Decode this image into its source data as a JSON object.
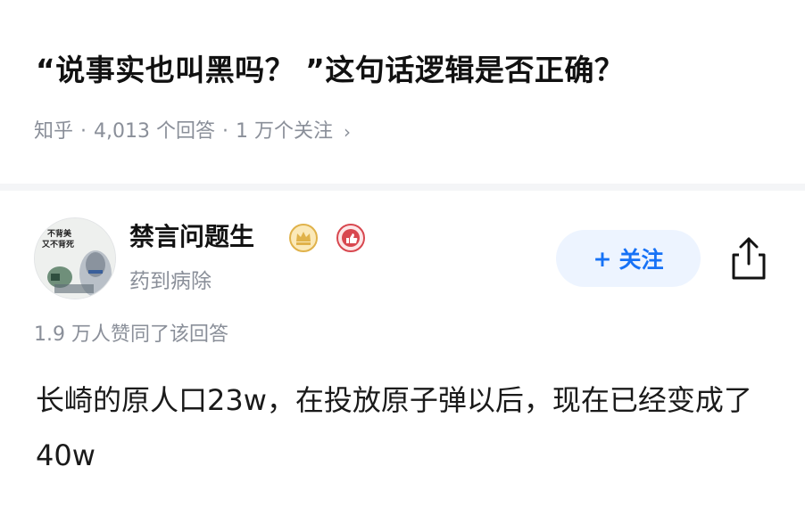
{
  "question": {
    "title": "“说事实也叫黑吗？ ”这句话逻辑是否正确？",
    "source": "知乎",
    "answer_count": "4,013 个回答",
    "follower_count": "1 万个关注"
  },
  "answer": {
    "author": {
      "name": "禁言问题生",
      "bio": "药到病除",
      "avatar_text_line1": "不背美",
      "avatar_text_line2": "又不背死"
    },
    "follow_label": "关注",
    "follow_plus": "+",
    "upvote_summary": "1.9 万人赞同了该回答",
    "body": "长崎的原人口23w，在投放原子弹以后，现在已经变成了40w"
  },
  "colors": {
    "accent": "#1772f6",
    "follow_bg": "#edf4ff",
    "meta_gray": "#8a8f99",
    "badge_gold": "#e0b24a",
    "badge_red": "#d8474f"
  },
  "icons": {
    "meta_chevron": "chevron-right-icon",
    "share": "share-icon",
    "badge_1": "crown-badge-icon",
    "badge_2": "like-badge-icon"
  }
}
